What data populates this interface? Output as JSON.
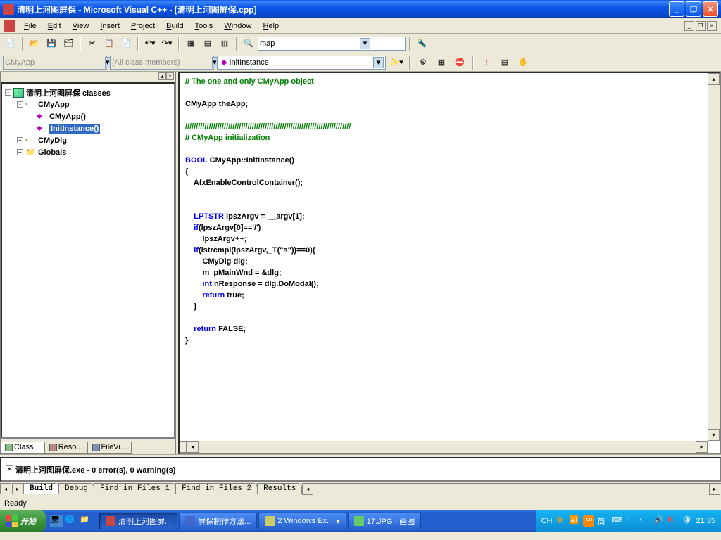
{
  "title": "清明上河图屏保 - Microsoft Visual C++ - [清明上河图屏保.cpp]",
  "menu": {
    "file": "File",
    "edit": "Edit",
    "view": "View",
    "insert": "Insert",
    "project": "Project",
    "build": "Build",
    "tools": "Tools",
    "window": "Window",
    "help": "Help"
  },
  "toolbar": {
    "find": "map"
  },
  "wizard": {
    "class": "CMyApp",
    "filter": "(All class members)",
    "member": "InitInstance"
  },
  "tree": {
    "root": "清明上河图屏保 classes",
    "n1": "CMyApp",
    "n1a": "CMyApp()",
    "n1b": "InitInstance()",
    "n2": "CMyDlg",
    "n3": "Globals"
  },
  "leftTabs": {
    "t1": "Class...",
    "t2": "Reso...",
    "t3": "FileVi..."
  },
  "code": {
    "l1": "// The one and only CMyApp object",
    "l2": "",
    "l3": "CMyApp theApp;",
    "l4": "",
    "l5": "/////////////////////////////////////////////////////////////////////////////",
    "l6": "// CMyApp initialization",
    "l7": "",
    "l8_a": "BOOL",
    "l8_b": " CMyApp::InitInstance()",
    "l9": "{",
    "l10": "    AfxEnableControlContainer();",
    "l11": "",
    "l12": "",
    "l13_a": "    LPTSTR",
    "l13_b": " lpszArgv = __argv[1];",
    "l14_a": "    if",
    "l14_b": "(lpszArgv[0]=='/')",
    "l15": "        lpszArgv++;",
    "l16_a": "    if",
    "l16_b": "(lstrcmpi(lpszArgv,_T(\"s\"))==0){",
    "l17": "        CMyDlg dlg;",
    "l18": "        m_pMainWnd = &dlg;",
    "l19_a": "        int",
    "l19_b": " nResponse = dlg.DoModal();",
    "l20_a": "        return",
    "l20_b": " true;",
    "l21": "    }",
    "l22": "",
    "l23_a": "    return",
    "l23_b": " FALSE;",
    "l24": "}"
  },
  "output": {
    "line": "清明上河图屏保.exe - 0 error(s), 0 warning(s)"
  },
  "outputTabs": {
    "t1": "Build",
    "t2": "Debug",
    "t3": "Find in Files 1",
    "t4": "Find in Files 2",
    "t5": "Results"
  },
  "status": "Ready",
  "taskbar": {
    "start": "开始",
    "t1": "清明上河图屏...",
    "t2": "屏保制作方法...",
    "t3": "2 Windows Ex...",
    "t4": "17.JPG - 画图",
    "ime": "CH",
    "time": "21:35"
  }
}
